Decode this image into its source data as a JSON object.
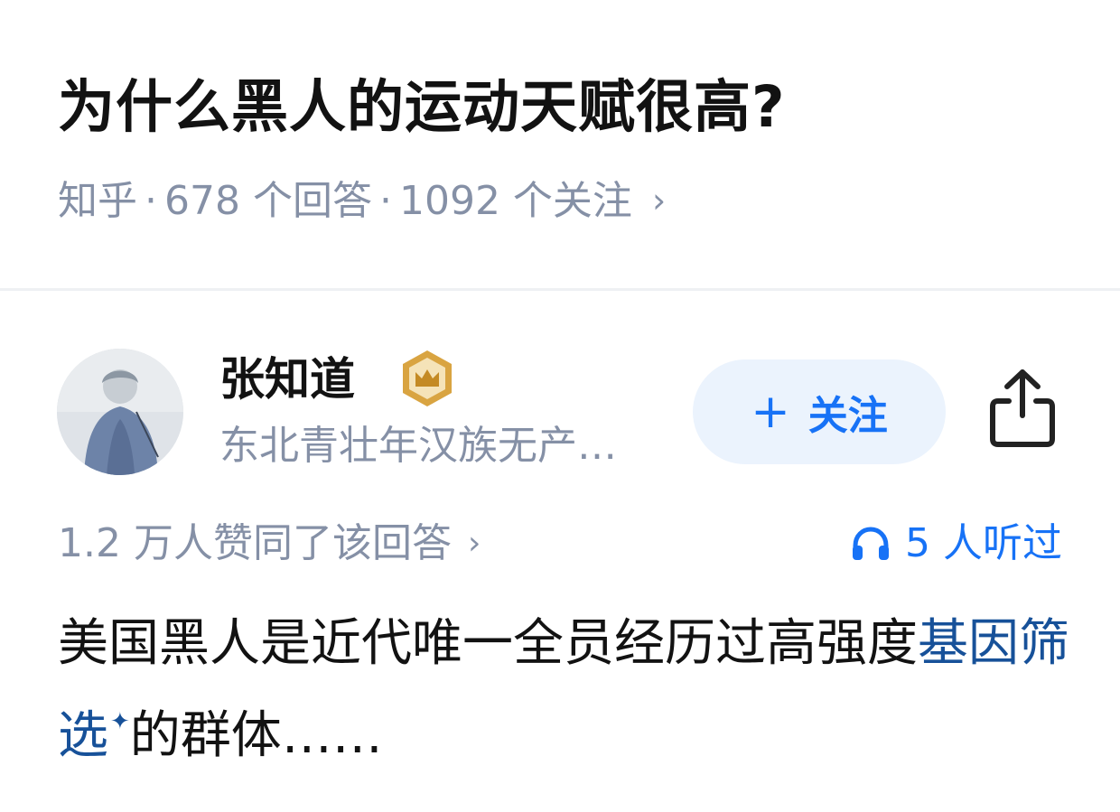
{
  "question": {
    "title": "为什么黑人的运动天赋很高?",
    "source": "知乎",
    "separator": "·",
    "answers": "678 个回答",
    "followers": "1092 个关注",
    "chevron": "›"
  },
  "author": {
    "name": "张知道",
    "badge_icon": "crown-badge-icon",
    "bio": "东北青壮年汉族无产…",
    "avatar_icon": "user-avatar"
  },
  "actions": {
    "follow_plus": "+",
    "follow_label": "关注",
    "share_icon": "share-icon"
  },
  "stats": {
    "votes": "1.2 万人赞同了该回答",
    "votes_chevron": "›",
    "listen_icon": "headphones-icon",
    "listeners": "5 人听过"
  },
  "answer": {
    "text_part1": "美国黑人是近代唯一全员经历过高强度",
    "keyword": "基因筛选",
    "keyword_mark": "✦",
    "text_part2": "的群体……"
  },
  "colors": {
    "accent": "#1772f6",
    "follow_bg": "#ebf3fd",
    "muted_text": "#8590a6",
    "primary_text": "#121212",
    "keyword_link": "#175199",
    "badge_gold": "#d9a441"
  }
}
